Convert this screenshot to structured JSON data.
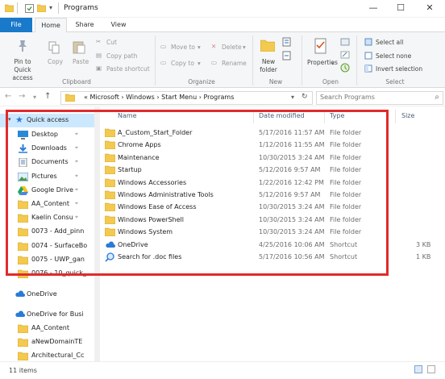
{
  "window": {
    "title": "Programs"
  },
  "tabs": {
    "file": "File",
    "home": "Home",
    "share": "Share",
    "view": "View"
  },
  "ribbon": {
    "pin": "Pin to Quick access",
    "copy": "Copy",
    "paste": "Paste",
    "cut": "Cut",
    "copy_path": "Copy path",
    "paste_shortcut": "Paste shortcut",
    "clipboard_group": "Clipboard",
    "move_to": "Move to",
    "copy_to": "Copy to",
    "delete": "Delete",
    "rename": "Rename",
    "organize_group": "Organize",
    "new_folder": "New folder",
    "new_group": "New",
    "properties": "Properties",
    "open_group": "Open",
    "select_all": "Select all",
    "select_none": "Select none",
    "invert_selection": "Invert selection",
    "select_group": "Select"
  },
  "address": {
    "crumbs": "«  Microsoft  ›  Windows  ›  Start Menu  ›  Programs",
    "search_placeholder": "Search Programs"
  },
  "nav": {
    "quick_access": "Quick access",
    "items": [
      {
        "label": "Desktop",
        "icon": "desktop-icon",
        "pinned": true
      },
      {
        "label": "Downloads",
        "icon": "download-icon",
        "pinned": true
      },
      {
        "label": "Documents",
        "icon": "documents-icon",
        "pinned": true
      },
      {
        "label": "Pictures",
        "icon": "pictures-icon",
        "pinned": true
      },
      {
        "label": "Google Drive",
        "icon": "google-drive-icon",
        "pinned": true
      },
      {
        "label": "AA_Content",
        "icon": "folder-icon",
        "pinned": true
      },
      {
        "label": "Kaelin Consu",
        "icon": "folder-icon",
        "pinned": true
      },
      {
        "label": "0073 - Add_pinn",
        "icon": "folder-icon",
        "pinned": false
      },
      {
        "label": "0074 - SurfaceBo",
        "icon": "folder-icon",
        "pinned": false
      },
      {
        "label": "0075 - UWP_gan",
        "icon": "folder-icon",
        "pinned": false
      },
      {
        "label": "0076 - 10_quick_",
        "icon": "folder-icon",
        "pinned": false
      }
    ],
    "onedrive": "OneDrive",
    "onedrive_business": "OneDrive for Busi",
    "business_items": [
      "AA_Content",
      "aNewDomainTE",
      "Architectural_Cc"
    ]
  },
  "columns": {
    "name": "Name",
    "date": "Date modified",
    "type": "Type",
    "size": "Size"
  },
  "files": [
    {
      "name": "A_Custom_Start_Folder",
      "date": "5/17/2016 11:57 AM",
      "type": "File folder",
      "size": "",
      "icon": "folder-icon"
    },
    {
      "name": "Chrome Apps",
      "date": "1/12/2016 11:55 AM",
      "type": "File folder",
      "size": "",
      "icon": "folder-icon"
    },
    {
      "name": "Maintenance",
      "date": "10/30/2015 3:24 AM",
      "type": "File folder",
      "size": "",
      "icon": "folder-icon"
    },
    {
      "name": "Startup",
      "date": "5/12/2016 9:57 AM",
      "type": "File folder",
      "size": "",
      "icon": "folder-icon"
    },
    {
      "name": "Windows Accessories",
      "date": "1/22/2016 12:42 PM",
      "type": "File folder",
      "size": "",
      "icon": "folder-icon"
    },
    {
      "name": "Windows Administrative Tools",
      "date": "5/12/2016 9:57 AM",
      "type": "File folder",
      "size": "",
      "icon": "folder-icon"
    },
    {
      "name": "Windows Ease of Access",
      "date": "10/30/2015 3:24 AM",
      "type": "File folder",
      "size": "",
      "icon": "folder-icon"
    },
    {
      "name": "Windows PowerShell",
      "date": "10/30/2015 3:24 AM",
      "type": "File folder",
      "size": "",
      "icon": "folder-icon"
    },
    {
      "name": "Windows System",
      "date": "10/30/2015 3:24 AM",
      "type": "File folder",
      "size": "",
      "icon": "folder-icon"
    },
    {
      "name": "OneDrive",
      "date": "4/25/2016 10:06 AM",
      "type": "Shortcut",
      "size": "3 KB",
      "icon": "onedrive-shortcut-icon"
    },
    {
      "name": "Search for .doc files",
      "date": "5/17/2016 10:56 AM",
      "type": "Shortcut",
      "size": "1 KB",
      "icon": "search-shortcut-icon"
    }
  ],
  "status": {
    "item_count": "11 items"
  },
  "colors": {
    "accent": "#1979ca",
    "folder": "#f3c94f",
    "highlight": "#e12b2b"
  }
}
